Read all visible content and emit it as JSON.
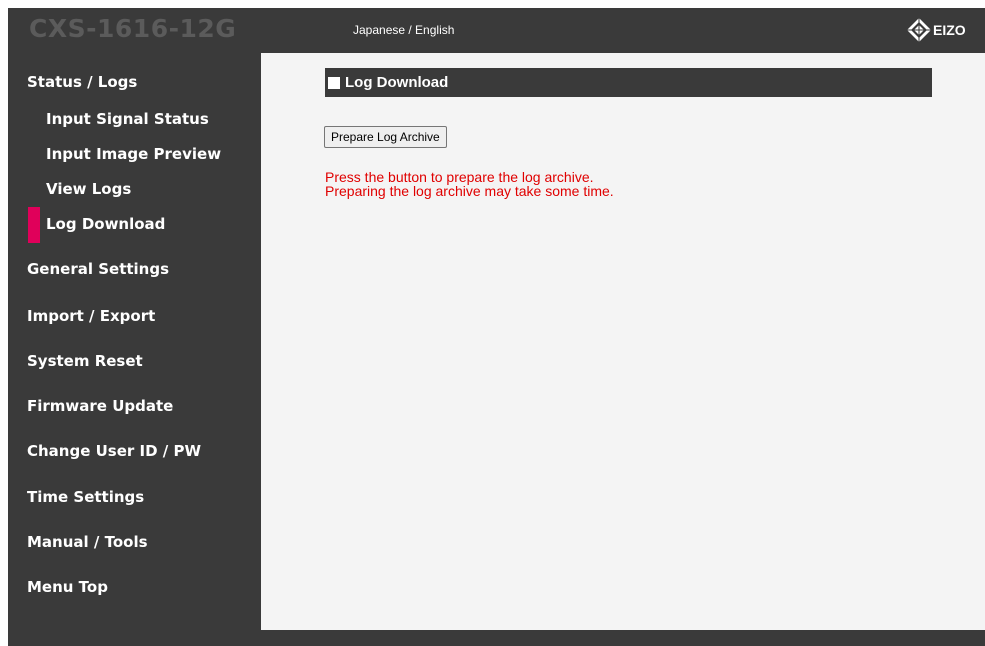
{
  "header": {
    "model_name": "CXS-1616-12G",
    "language_switch": "Japanese / English",
    "logo_text": "EIZO"
  },
  "sidebar": {
    "items": [
      {
        "label": "Status / Logs",
        "level": "top",
        "active": false
      },
      {
        "label": "Input Signal Status",
        "level": "sub",
        "active": false
      },
      {
        "label": "Input Image Preview",
        "level": "sub",
        "active": false
      },
      {
        "label": "View Logs",
        "level": "sub",
        "active": false
      },
      {
        "label": "Log Download",
        "level": "sub",
        "active": true
      },
      {
        "label": "General Settings",
        "level": "top",
        "active": false
      },
      {
        "label": "Import / Export",
        "level": "top",
        "active": false
      },
      {
        "label": "System Reset",
        "level": "top",
        "active": false
      },
      {
        "label": "Firmware Update",
        "level": "top",
        "active": false
      },
      {
        "label": "Change User ID / PW",
        "level": "top",
        "active": false
      },
      {
        "label": "Time Settings",
        "level": "top",
        "active": false
      },
      {
        "label": "Manual / Tools",
        "level": "top",
        "active": false
      },
      {
        "label": "Menu Top",
        "level": "top",
        "active": false
      }
    ]
  },
  "main": {
    "section_title": "Log Download",
    "prepare_button_label": "Prepare Log Archive",
    "message_line1": "Press the button to prepare the log archive.",
    "message_line2": "Preparing the log archive may take some time."
  },
  "colors": {
    "frame": "#3a3a3a",
    "content_background": "#f4f4f4",
    "active_accent": "#e0005a",
    "message_text": "#e00000"
  },
  "icons": {
    "logo": "eizo-diamond-logo-icon",
    "section_marker": "square-bullet-icon"
  }
}
